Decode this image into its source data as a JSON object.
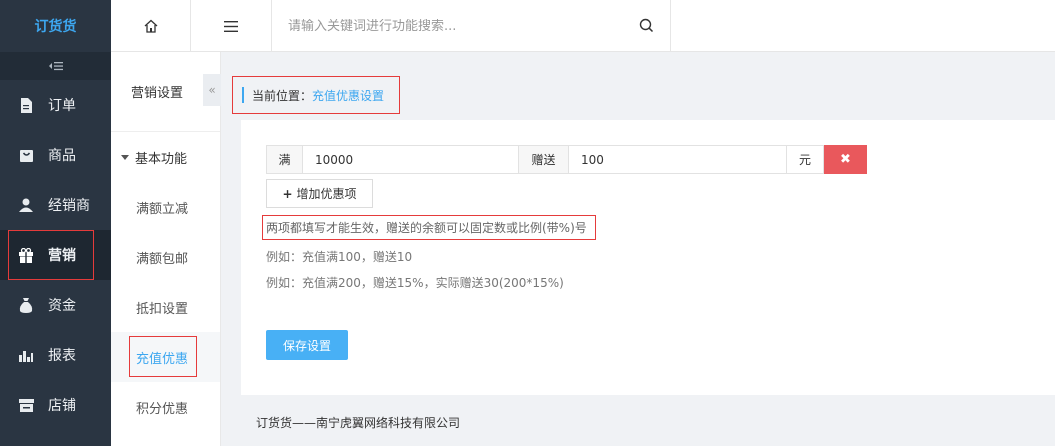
{
  "app": {
    "logo_text": "订货货"
  },
  "sidebar": {
    "collapse_icon": "menu-collapse-icon",
    "items": [
      {
        "label": "订单",
        "icon": "document-icon"
      },
      {
        "label": "商品",
        "icon": "bag-icon"
      },
      {
        "label": "经销商",
        "icon": "user-icon"
      },
      {
        "label": "营销",
        "icon": "gift-icon",
        "active": true
      },
      {
        "label": "资金",
        "icon": "money-bag-icon"
      },
      {
        "label": "报表",
        "icon": "bar-chart-icon"
      },
      {
        "label": "店铺",
        "icon": "shop-icon"
      }
    ]
  },
  "topbar": {
    "home_icon": "home-icon",
    "menu_icon": "hamburger-icon",
    "search_placeholder": "请输入关键词进行功能搜索...",
    "search_icon": "search-icon"
  },
  "subnav": {
    "title": "营销设置",
    "group": "基本功能",
    "items": [
      {
        "label": "满额立减"
      },
      {
        "label": "满额包邮"
      },
      {
        "label": "抵扣设置"
      },
      {
        "label": "充值优惠",
        "active": true
      },
      {
        "label": "积分优惠"
      }
    ],
    "toggle_glyph": "«"
  },
  "breadcrumb": {
    "prefix": "当前位置：",
    "current": "充值优惠设置"
  },
  "form": {
    "full_label": "满",
    "full_value": "10000",
    "gift_label": "赠送",
    "gift_value": "100",
    "unit": "元",
    "delete_glyph": "✖",
    "add_label": "增加优惠项",
    "hint": "两项都填写才能生效，赠送的余额可以固定数或比例(带%)号",
    "example1": "例如：充值满100，赠送10",
    "example2": "例如：充值满200，赠送15%，实际赠送30(200*15%)",
    "save_label": "保存设置"
  },
  "footer": {
    "text": "订货货——南宁虎翼网络科技有限公司"
  },
  "colors": {
    "accent": "#3da7f0",
    "sidebar_bg": "#2a3542",
    "danger": "#e9585c",
    "highlight_border": "#e53b3b"
  }
}
